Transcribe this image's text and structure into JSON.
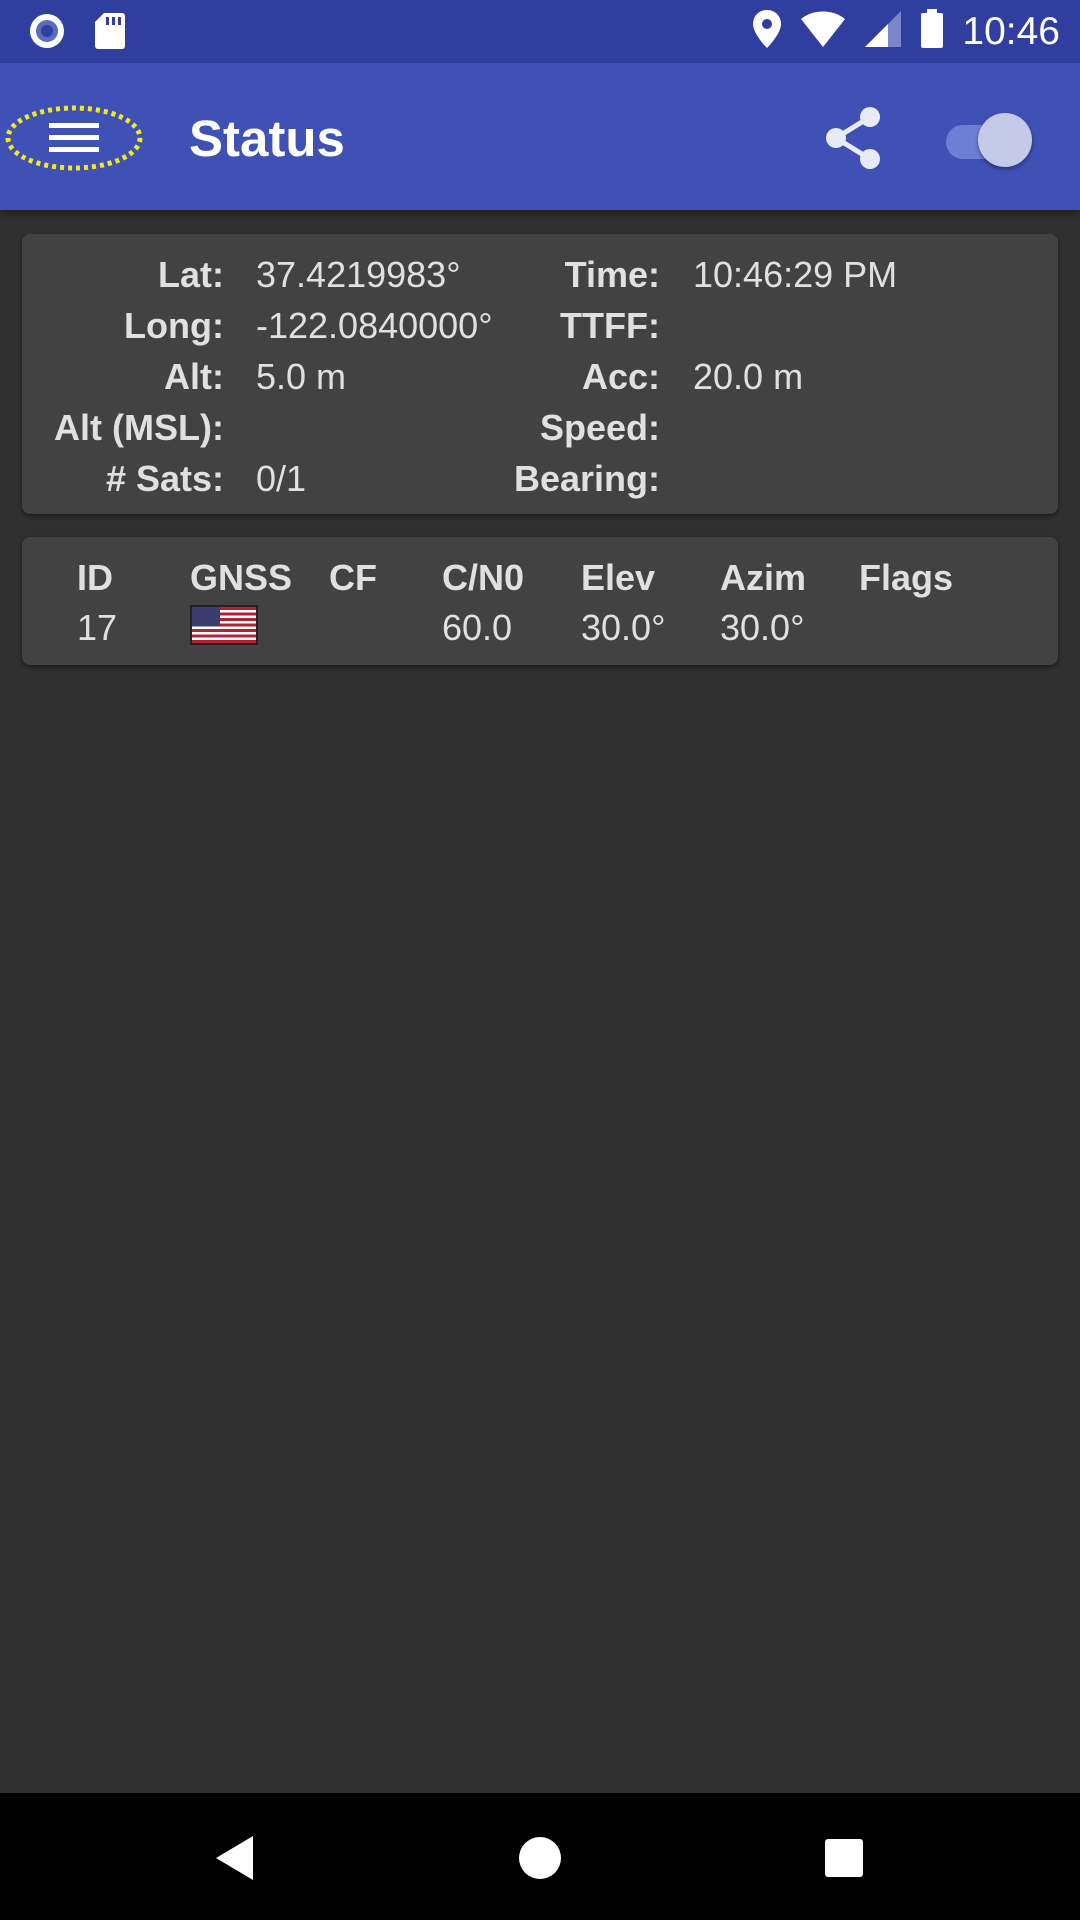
{
  "status_bar": {
    "time": "10:46",
    "icons": [
      "notification-circle-icon",
      "sd-card-icon",
      "location-icon",
      "wifi-icon",
      "cell-signal-icon",
      "battery-icon"
    ]
  },
  "app_bar": {
    "title": "Status",
    "menu_icon": "hamburger-menu-icon",
    "share_icon": "share-icon",
    "toggle_state": "on",
    "colors": {
      "app_bar": "#3f51b5",
      "status_bar": "#303f9f",
      "background": "#303030",
      "card": "#424242"
    }
  },
  "location": {
    "lat_label": "Lat:",
    "lat_value": "37.4219983°",
    "long_label": "Long:",
    "long_value": "-122.0840000°",
    "alt_label": "Alt:",
    "alt_value": "5.0 m",
    "alt_msl_label": "Alt (MSL):",
    "alt_msl_value": "",
    "sats_label": "# Sats:",
    "sats_value": "0/1",
    "time_label": "Time:",
    "time_value": "10:46:29 PM",
    "ttff_label": "TTFF:",
    "ttff_value": "",
    "acc_label": "Acc:",
    "acc_value": "20.0 m",
    "speed_label": "Speed:",
    "speed_value": "",
    "bearing_label": "Bearing:",
    "bearing_value": ""
  },
  "satellites": {
    "headers": [
      "ID",
      "GNSS",
      "CF",
      "C/N0",
      "Elev",
      "Azim",
      "Flags"
    ],
    "rows": [
      {
        "id": "17",
        "gnss": "us-flag-icon",
        "cf": "",
        "cn0": "60.0",
        "elev": "30.0°",
        "azim": "30.0°",
        "flags": ""
      }
    ]
  },
  "nav_bar": {
    "icons": [
      "back-icon",
      "home-icon",
      "recents-icon"
    ]
  }
}
